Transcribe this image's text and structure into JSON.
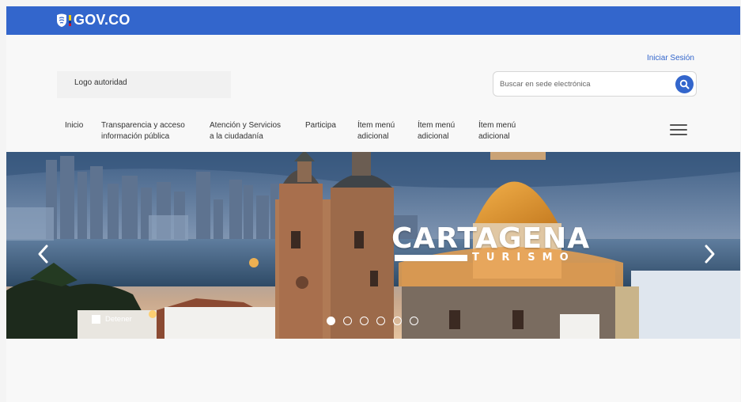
{
  "topbar": {
    "brand": "GOV.CO",
    "color": "#3366cc"
  },
  "header": {
    "login_link": "Iniciar Sesión",
    "logo_authority": "Logo autoridad",
    "search_placeholder": "Buscar en sede electrónica"
  },
  "nav": {
    "items": [
      {
        "label": "Inicio"
      },
      {
        "label": "Transparencia y acceso\ninformación pública"
      },
      {
        "label": "Atención y Servicios\na la ciudadanía"
      },
      {
        "label": "Participa"
      },
      {
        "label": "Ítem menú\nadicional"
      },
      {
        "label": "Ítem menú\nadicional"
      },
      {
        "label": "Ítem menú\nadicional"
      }
    ],
    "menu_icon": "hamburger-icon"
  },
  "carousel": {
    "title": "CARTAGENA",
    "subtitle": "TURISMO",
    "stop_label": "Detener",
    "slide_count": 6,
    "active_slide": 1,
    "prev_icon": "chevron-left-icon",
    "next_icon": "chevron-right-icon"
  }
}
